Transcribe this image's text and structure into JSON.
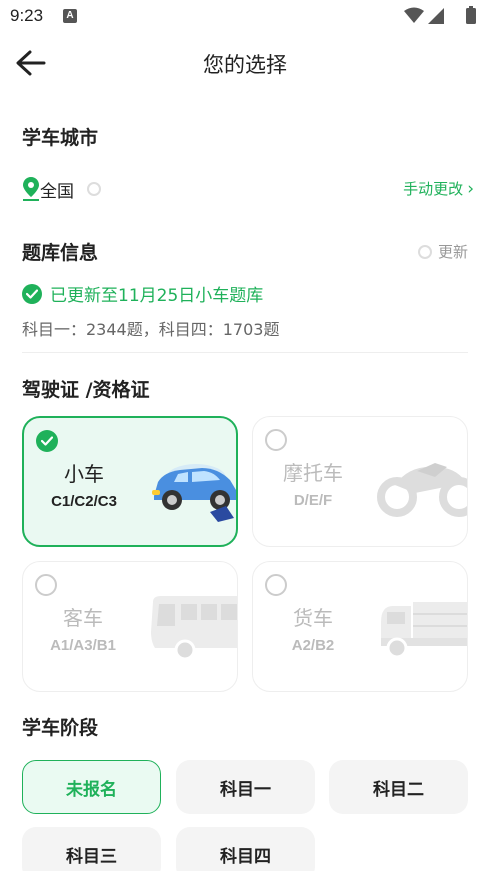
{
  "status_bar": {
    "time": "9:23",
    "notification_letter": "A"
  },
  "header": {
    "title": "您的选择"
  },
  "city_section": {
    "title": "学车城市",
    "current_city": "全国",
    "change_label": "手动更改",
    "change_chevron": "›"
  },
  "bank_section": {
    "title": "题库信息",
    "update_label": "更新",
    "updated_text": "已更新至11月25日小车题库",
    "counts_text": "科目一：2344题，科目四：1703题"
  },
  "license_section": {
    "title": "驾驶证 /资格证",
    "options": [
      {
        "name": "小车",
        "code": "C1/C2/C3",
        "selected": true,
        "icon": "car-icon"
      },
      {
        "name": "摩托车",
        "code": "D/E/F",
        "selected": false,
        "icon": "motorcycle-icon"
      },
      {
        "name": "客车",
        "code": "A1/A3/B1",
        "selected": false,
        "icon": "bus-icon"
      },
      {
        "name": "货车",
        "code": "A2/B2",
        "selected": false,
        "icon": "truck-icon"
      }
    ]
  },
  "stage_section": {
    "title": "学车阶段",
    "options": [
      {
        "label": "未报名",
        "active": true
      },
      {
        "label": "科目一",
        "active": false
      },
      {
        "label": "科目二",
        "active": false
      },
      {
        "label": "科目三",
        "active": false
      },
      {
        "label": "科目四",
        "active": false
      }
    ]
  },
  "colors": {
    "accent": "#1fb15a",
    "selected_bg": "#eaf9f2",
    "muted": "#bbbbbb"
  }
}
